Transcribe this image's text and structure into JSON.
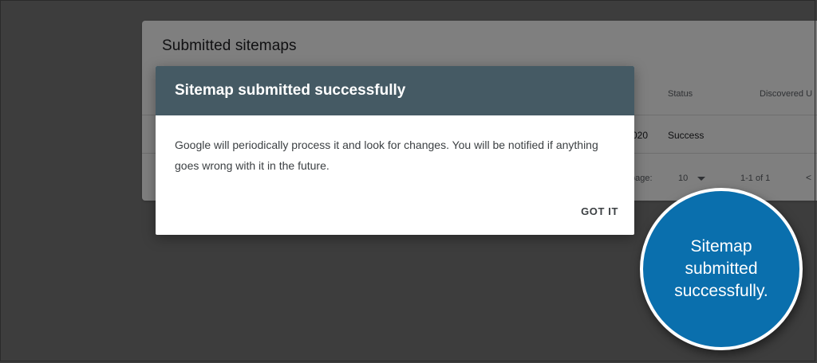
{
  "background": {
    "card_title": "Submitted sitemaps",
    "columns": {
      "status": "Status",
      "discovered": "Discovered U"
    },
    "row": {
      "date_fragment": "020",
      "status": "Success"
    },
    "pagination": {
      "rows_per_page_label": "page:",
      "rows_per_page_value": "10",
      "range": "1-1 of 1",
      "prev_glyph": "<"
    }
  },
  "dialog": {
    "title": "Sitemap submitted successfully",
    "body": "Google will periodically process it and look for changes. You will be notified if anything goes wrong with it in the future.",
    "action_label": "GOT IT"
  },
  "callout": {
    "text": "Sitemap submitted successfully."
  },
  "colors": {
    "dialog_header": "#455a64",
    "callout_fill": "#0a6fad",
    "overlay": "rgba(0,0,0,0.5)"
  }
}
